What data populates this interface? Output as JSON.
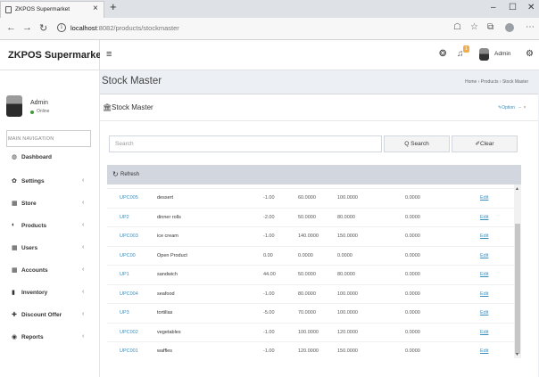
{
  "browser": {
    "tab_title": "ZKPOS Supermarket",
    "tab_close": "×",
    "new_tab": "+",
    "url_host": "localhost",
    "url_rest": ":8082/products/stockmaster",
    "url_info": "i",
    "window": {
      "min": "–",
      "max": "☐",
      "close": "✕"
    }
  },
  "header": {
    "brand": "ZKPOS Supermarket",
    "user": "Admin",
    "notification_count": "1"
  },
  "sidebar": {
    "user": "Admin",
    "status": "Online",
    "section_header": "MAIN NAVIGATION",
    "items": [
      {
        "label": "Dashboard",
        "icon": "dashboard-icon",
        "glyph": "◍",
        "caret": ""
      },
      {
        "label": "Settings",
        "icon": "gear-icon",
        "glyph": "✿",
        "caret": "‹"
      },
      {
        "label": "Store",
        "icon": "store-icon",
        "glyph": "▦",
        "caret": "‹"
      },
      {
        "label": "Products",
        "icon": "products-icon",
        "glyph": "◐",
        "caret": "‹"
      },
      {
        "label": "Users",
        "icon": "users-icon",
        "glyph": "▦",
        "caret": "‹"
      },
      {
        "label": "Accounts",
        "icon": "accounts-icon",
        "glyph": "▦",
        "caret": "‹"
      },
      {
        "label": "Inventory",
        "icon": "inventory-icon",
        "glyph": "▮",
        "caret": "‹"
      },
      {
        "label": "Discount Offer",
        "icon": "plus-icon",
        "glyph": "✚",
        "caret": "‹"
      },
      {
        "label": "Reports",
        "icon": "reports-icon",
        "glyph": "◉",
        "caret": "‹"
      }
    ]
  },
  "page": {
    "title": "Stock Master",
    "breadcrumb": "Home › Products › Stock Master",
    "box_title": "Stock Master",
    "options_label": "Option",
    "search_placeholder": "Search",
    "search_button": "Q Search",
    "clear_button": "Clear",
    "refresh_label": "Refresh"
  },
  "table": {
    "rows": [
      {
        "code": "UPC005",
        "name": "dessert",
        "qty": "-1.00",
        "cost": "60.0000",
        "price": "100.0000",
        "discount": "0.0000",
        "action": "Edit"
      },
      {
        "code": "UP2",
        "name": "dinner rolls",
        "qty": "-2.00",
        "cost": "50.0000",
        "price": "80.0000",
        "discount": "0.0000",
        "action": "Edit"
      },
      {
        "code": "UPC003",
        "name": "ice cream",
        "qty": "-1.00",
        "cost": "140.0000",
        "price": "150.0000",
        "discount": "0.0000",
        "action": "Edit"
      },
      {
        "code": "UPC00",
        "name": "Open Product",
        "qty": "0.00",
        "cost": "0.0000",
        "price": "0.0000",
        "discount": "0.0000",
        "action": "Edit"
      },
      {
        "code": "UP1",
        "name": "sandwich",
        "qty": "44.00",
        "cost": "50.0000",
        "price": "80.0000",
        "discount": "0.0000",
        "action": "Edit"
      },
      {
        "code": "UPC004",
        "name": "seafood",
        "qty": "-1.00",
        "cost": "80.0000",
        "price": "100.0000",
        "discount": "0.0000",
        "action": "Edit"
      },
      {
        "code": "UP3",
        "name": "tortillas",
        "qty": "-5.00",
        "cost": "70.0000",
        "price": "100.0000",
        "discount": "0.0000",
        "action": "Edit"
      },
      {
        "code": "UPC002",
        "name": "vegetables",
        "qty": "-1.00",
        "cost": "100.0000",
        "price": "120.0000",
        "discount": "0.0000",
        "action": "Edit"
      },
      {
        "code": "UPC001",
        "name": "waffles",
        "qty": "-1.00",
        "cost": "120.0000",
        "price": "150.0000",
        "discount": "0.0000",
        "action": "Edit"
      }
    ]
  },
  "colors": {
    "accent": "#3c8dbc",
    "content_bg": "#ecf0f5",
    "grid_bar": "#d2d6de",
    "online": "#3c9a3c"
  }
}
